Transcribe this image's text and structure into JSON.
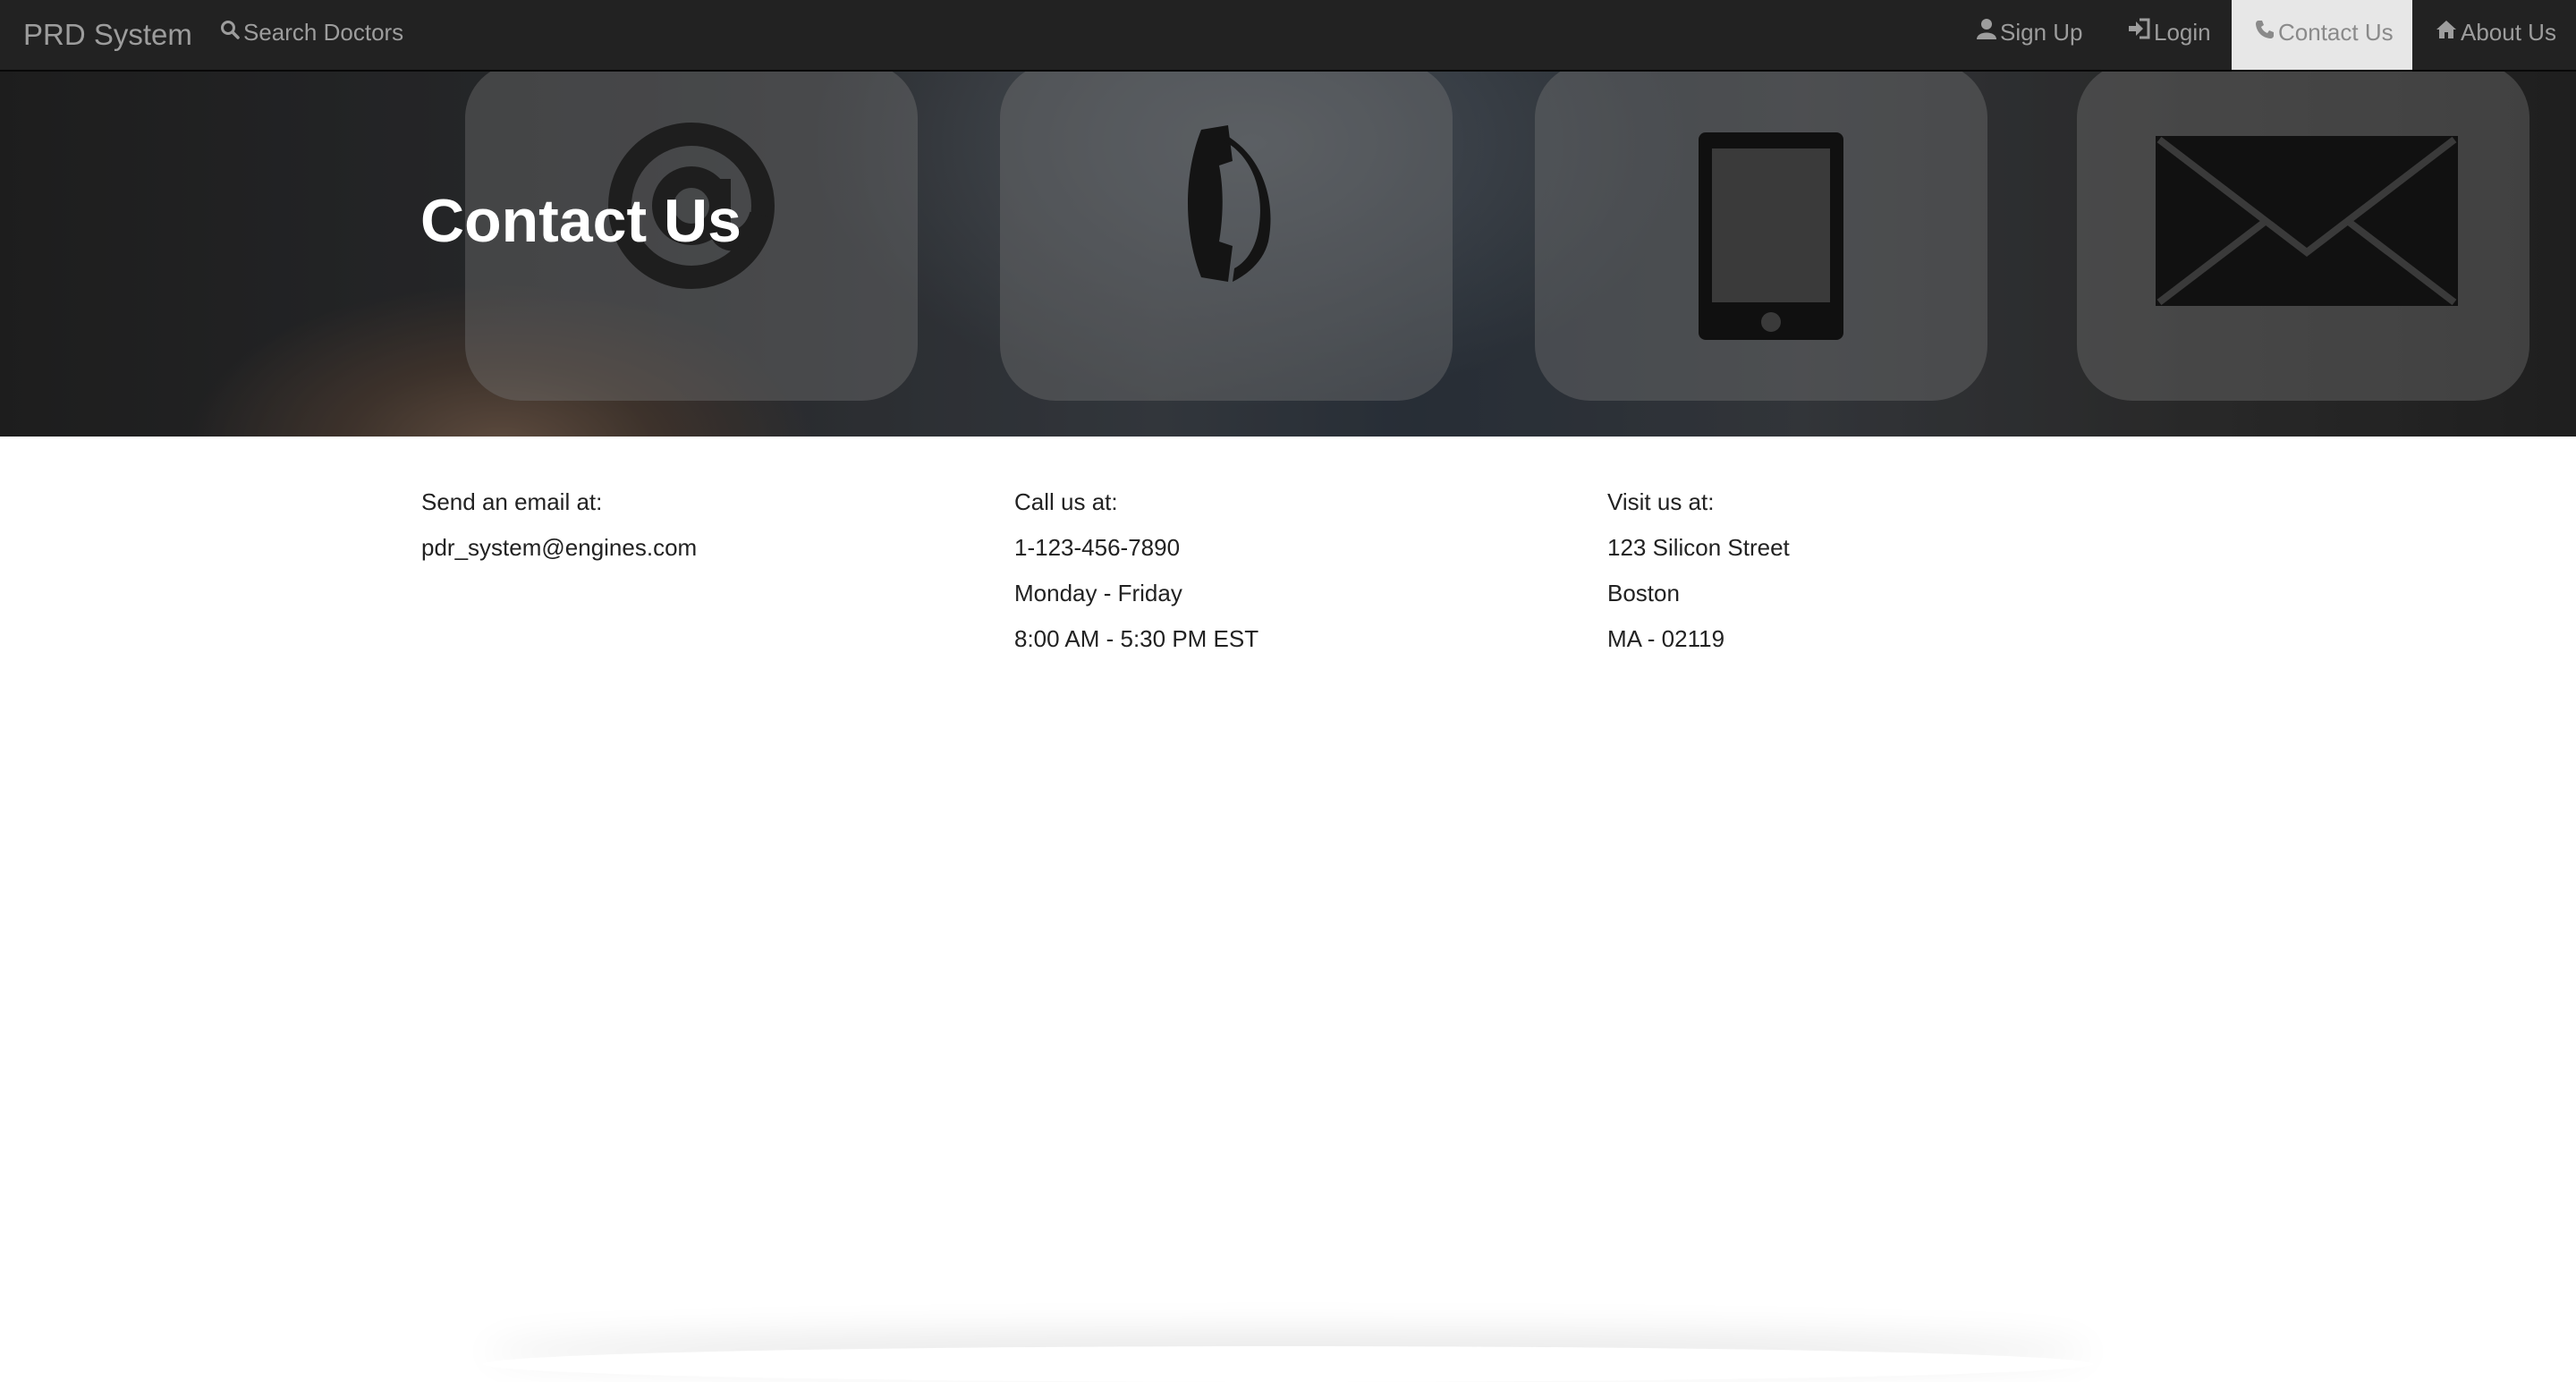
{
  "navbar": {
    "brand": "PRD System",
    "search": {
      "label": "Search Doctors",
      "icon": "search-icon"
    },
    "signup": {
      "label": "Sign Up",
      "icon": "user-icon"
    },
    "login": {
      "label": "Login",
      "icon": "login-icon"
    },
    "contact": {
      "label": "Contact Us",
      "icon": "phone-icon",
      "active": true
    },
    "about": {
      "label": "About Us",
      "icon": "home-icon"
    }
  },
  "hero": {
    "title": "Contact Us",
    "icons": [
      "at-sign-icon",
      "telephone-icon",
      "mobile-phone-icon",
      "envelope-icon"
    ]
  },
  "contact": {
    "email": {
      "heading": "Send an email at:",
      "address": "pdr_system@engines.com"
    },
    "call": {
      "heading": "Call us at:",
      "phone": "1-123-456-7890",
      "days": "Monday - Friday",
      "hours": "8:00 AM - 5:30 PM EST"
    },
    "visit": {
      "heading": "Visit us at:",
      "street": "123 Silicon Street",
      "city": "Boston",
      "state_zip": "MA - 02119"
    }
  },
  "colors": {
    "navbar_bg": "#222222",
    "nav_text": "#9d9d9d",
    "active_tab_bg": "#e7e7e7",
    "body_text": "#222222"
  }
}
